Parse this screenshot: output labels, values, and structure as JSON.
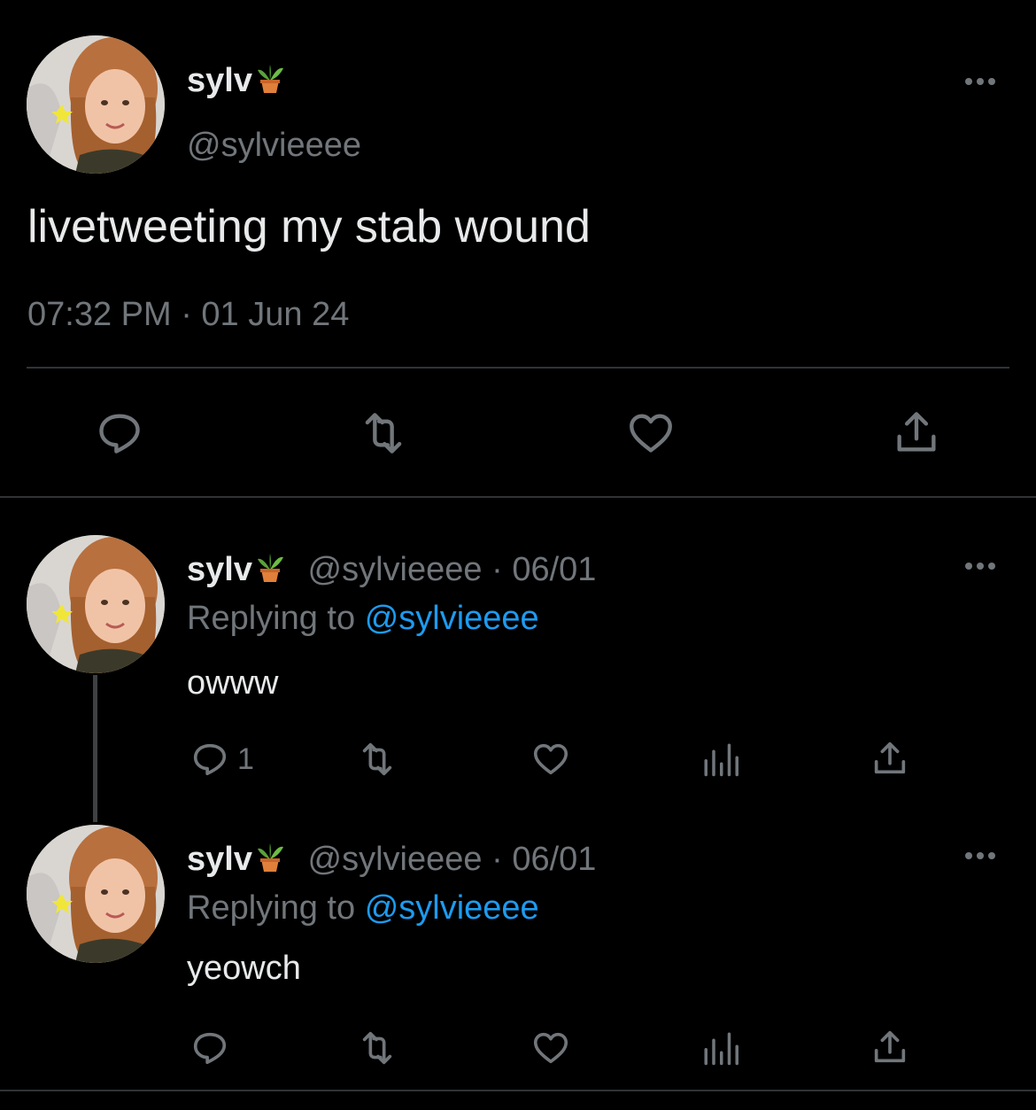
{
  "main_tweet": {
    "display_name": "sylv",
    "name_emoji": "potted-plant-emoji",
    "handle": "@sylvieeee",
    "text": "livetweeting my stab wound",
    "timestamp": "07:32 PM · 01 Jun 24",
    "actions": [
      "reply-icon",
      "retweet-icon",
      "like-icon",
      "share-icon"
    ]
  },
  "replies": [
    {
      "display_name": "sylv",
      "handle": "@sylvieeee",
      "separator": "·",
      "date": "06/01",
      "replying_label": "Replying to",
      "replying_handle": "@sylvieeee",
      "text": "owww",
      "reply_count": "1"
    },
    {
      "display_name": "sylv",
      "handle": "@sylvieeee",
      "separator": "·",
      "date": "06/01",
      "replying_label": "Replying to",
      "replying_handle": "@sylvieeee",
      "text": "yeowch",
      "reply_count": ""
    }
  ],
  "colors": {
    "background": "#000000",
    "text": "#e7e9ea",
    "muted": "#71767b",
    "link": "#1d9bf0",
    "divider": "#2f3336"
  }
}
